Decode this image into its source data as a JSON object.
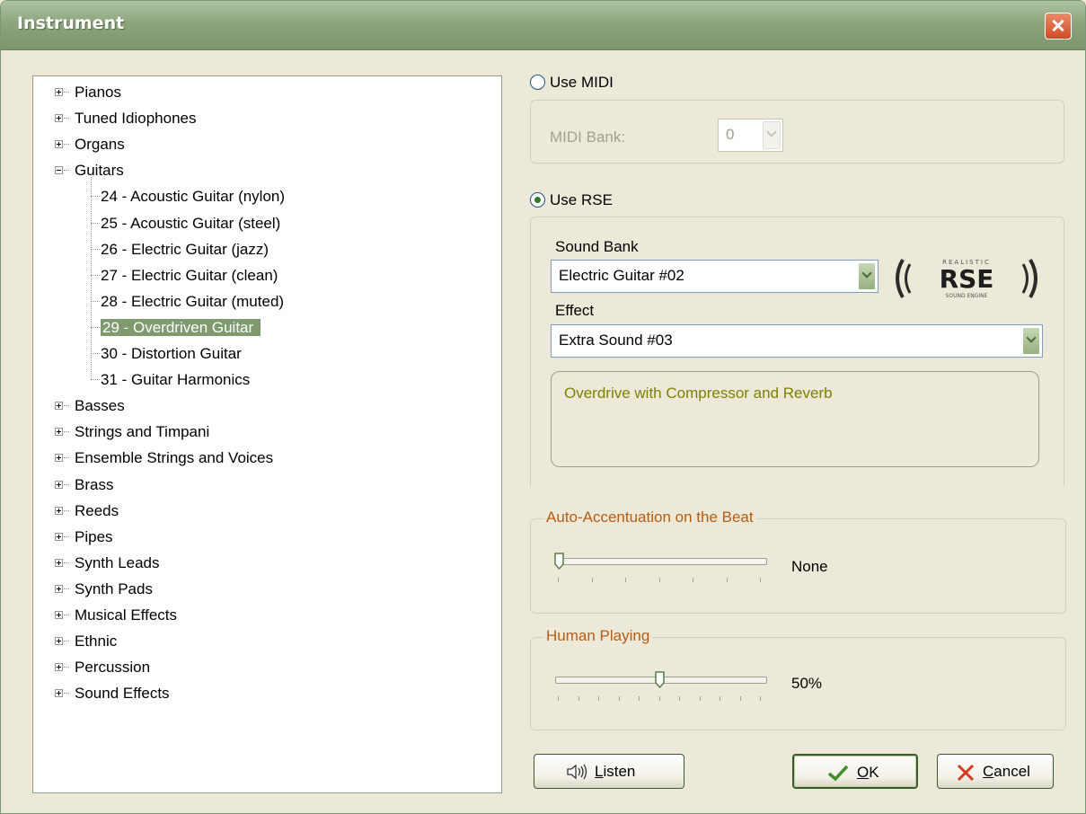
{
  "window": {
    "title": "Instrument"
  },
  "tree": {
    "items": [
      {
        "label": "Pianos",
        "level": 0,
        "expanded": false
      },
      {
        "label": "Tuned Idiophones",
        "level": 0,
        "expanded": false
      },
      {
        "label": "Organs",
        "level": 0,
        "expanded": false
      },
      {
        "label": "Guitars",
        "level": 0,
        "expanded": true
      },
      {
        "label": "24 - Acoustic Guitar (nylon)",
        "level": 1
      },
      {
        "label": "25 - Acoustic Guitar (steel)",
        "level": 1
      },
      {
        "label": "26 - Electric Guitar (jazz)",
        "level": 1
      },
      {
        "label": "27 - Electric Guitar (clean)",
        "level": 1
      },
      {
        "label": "28 - Electric Guitar (muted)",
        "level": 1
      },
      {
        "label": "29 - Overdriven Guitar",
        "level": 1,
        "selected": true
      },
      {
        "label": "30 - Distortion Guitar",
        "level": 1
      },
      {
        "label": "31 - Guitar Harmonics",
        "level": 1
      },
      {
        "label": "Basses",
        "level": 0,
        "expanded": false
      },
      {
        "label": "Strings and Timpani",
        "level": 0,
        "expanded": false
      },
      {
        "label": "Ensemble Strings and Voices",
        "level": 0,
        "expanded": false
      },
      {
        "label": "Brass",
        "level": 0,
        "expanded": false
      },
      {
        "label": "Reeds",
        "level": 0,
        "expanded": false
      },
      {
        "label": "Pipes",
        "level": 0,
        "expanded": false
      },
      {
        "label": "Synth Leads",
        "level": 0,
        "expanded": false
      },
      {
        "label": "Synth Pads",
        "level": 0,
        "expanded": false
      },
      {
        "label": "Musical Effects",
        "level": 0,
        "expanded": false
      },
      {
        "label": "Ethnic",
        "level": 0,
        "expanded": false
      },
      {
        "label": "Percussion",
        "level": 0,
        "expanded": false
      },
      {
        "label": "Sound Effects",
        "level": 0,
        "expanded": false
      }
    ]
  },
  "midi": {
    "radio_label": "Use MIDI",
    "checked": false,
    "bank_label": "MIDI Bank:",
    "bank_value": "0"
  },
  "rse": {
    "radio_label": "Use RSE",
    "checked": true,
    "sound_bank_label": "Sound Bank",
    "sound_bank_value": "Electric Guitar #02",
    "effect_label": "Effect",
    "effect_value": "Extra Sound #03",
    "description": "Overdrive with Compressor and Reverb",
    "logo": {
      "top": "REALISTIC",
      "main": "RSE",
      "bottom": "SOUND ENGINE"
    }
  },
  "accentuation": {
    "title": "Auto-Accentuation on the Beat",
    "value_label": "None",
    "level": 0,
    "ticks": 7
  },
  "human": {
    "title": "Human Playing",
    "value_label": "50%",
    "level": 0.5,
    "ticks": 11
  },
  "buttons": {
    "listen": {
      "prefix": "",
      "hotkey": "L",
      "rest": "isten",
      "icon": "speaker-icon"
    },
    "ok": {
      "hotkey": "O",
      "rest": "K",
      "icon": "checkmark-icon"
    },
    "cancel": {
      "hotkey": "C",
      "rest": "ancel",
      "icon": "x-icon"
    }
  },
  "colors": {
    "selection": "#7e9a6e",
    "description_text": "#808000",
    "group_title": "#b65c12"
  }
}
